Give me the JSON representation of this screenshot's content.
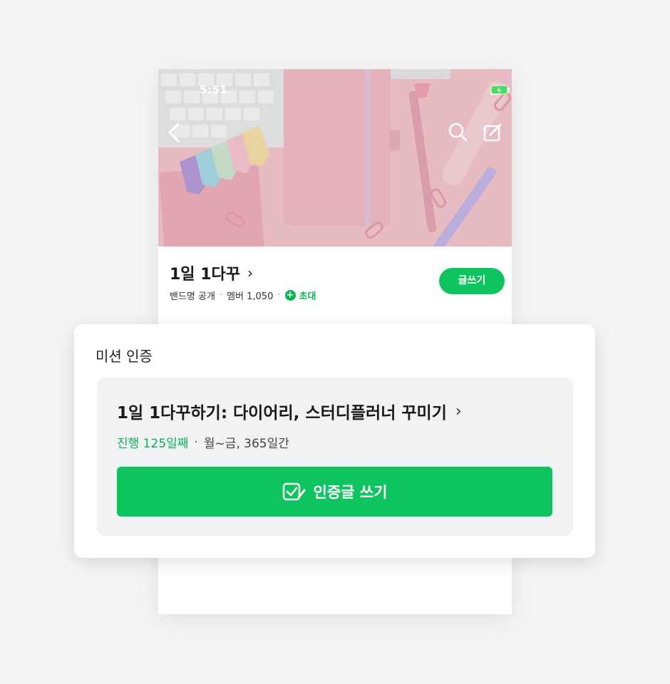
{
  "status_bar": {
    "time": "5:51"
  },
  "band": {
    "title": "1일 1다꾸",
    "chevron": "›",
    "meta": {
      "visibility": "밴드명 공개",
      "members": "멤버 1,050",
      "invite": "초대",
      "separator": "·"
    },
    "write_button": "글쓰기"
  },
  "mission": {
    "header": "미션 인증",
    "title": "1일 1다꾸하기: 다이어리, 스터디플러너 꾸미기",
    "chevron": "›",
    "progress": "진행 125일째",
    "separator": "·",
    "schedule": "월~금, 365일간",
    "cert_button": "인증글 쓰기"
  },
  "colors": {
    "accent_green": "#0ec45f",
    "progress_green": "#0ab155",
    "cover_pink": "#f4c9cf",
    "background": "#f2f4f5"
  },
  "icons": [
    "back-arrow-icon",
    "search-icon",
    "edit-icon",
    "signal-icon",
    "wifi-icon",
    "battery-icon",
    "plus-circle-icon",
    "checkbox-pen-icon"
  ]
}
